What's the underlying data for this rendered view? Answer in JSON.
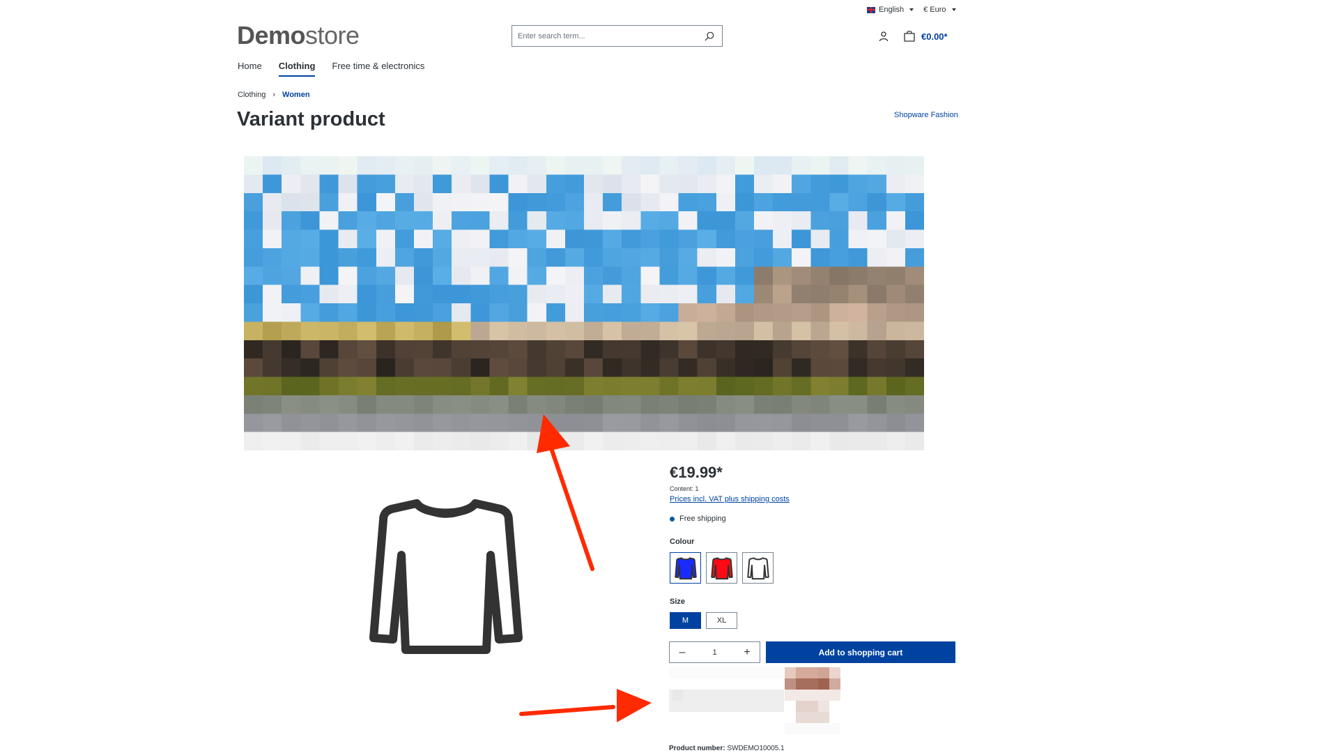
{
  "topbar": {
    "language": {
      "icon": "flag-uk-icon",
      "label": "English"
    },
    "currency": {
      "label": "€ Euro"
    }
  },
  "header": {
    "logo": {
      "bold": "Demo",
      "light": "store"
    },
    "search": {
      "placeholder": "Enter search term...",
      "value": ""
    },
    "cart_total": "€0.00*"
  },
  "nav": {
    "items": [
      {
        "label": "Home",
        "active": false
      },
      {
        "label": "Clothing",
        "active": true
      },
      {
        "label": "Free time & electronics",
        "active": false
      }
    ]
  },
  "breadcrumb": {
    "items": [
      "Clothing",
      "Women"
    ],
    "separator": "›"
  },
  "product": {
    "title": "Variant product",
    "manufacturer": "Shopware Fashion",
    "price": "€19.99*",
    "content": "Content: 1",
    "vat_link": "Prices incl. VAT plus shipping costs",
    "shipping": "Free shipping",
    "colour_label": "Colour",
    "colours": [
      {
        "name": "blue",
        "hex": "#1a2bff",
        "selected": true
      },
      {
        "name": "red",
        "hex": "#ff0a14",
        "selected": false
      },
      {
        "name": "white",
        "hex": "#ffffff",
        "selected": false
      }
    ],
    "size_label": "Size",
    "sizes": [
      {
        "label": "M",
        "selected": true
      },
      {
        "label": "XL",
        "selected": false
      }
    ],
    "quantity": "1",
    "add_to_cart": "Add to shopping cart",
    "product_number_label": "Product number:",
    "product_number": "SWDEMO10005.1"
  },
  "colors": {
    "accent": "#0042a0",
    "text": "#2b3136",
    "annotation": "#ff2a00"
  }
}
